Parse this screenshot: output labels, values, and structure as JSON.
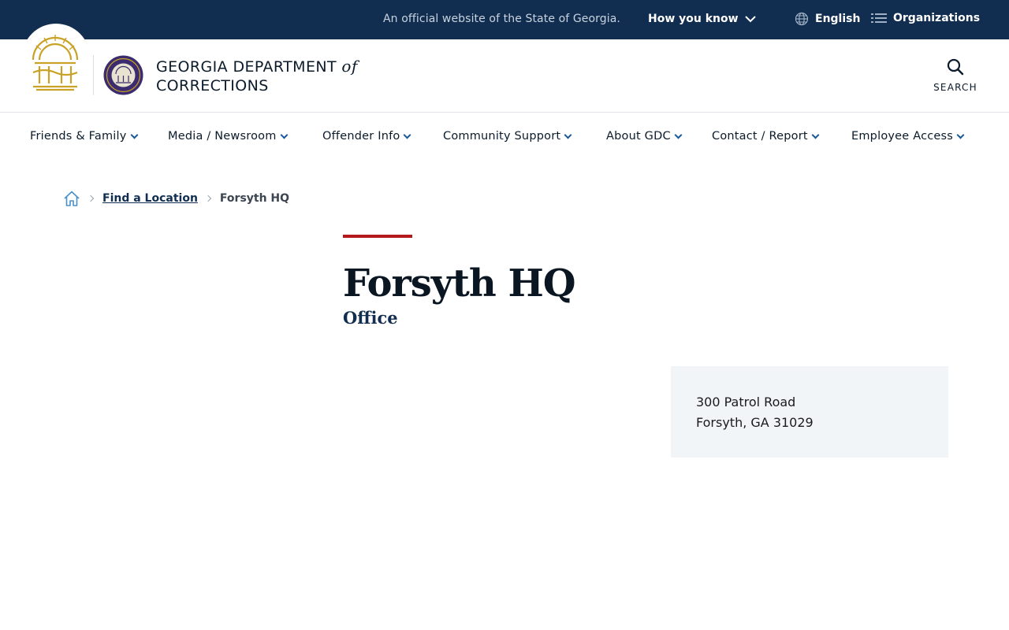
{
  "topbar": {
    "official_text": "An official website of the State of Georgia.",
    "how_you_know": "How you know",
    "language": "English",
    "organizations": "Organizations"
  },
  "header": {
    "agency_line1": "GEORGIA DEPARTMENT",
    "agency_of": "of",
    "agency_line2": "CORRECTIONS",
    "search_label": "SEARCH"
  },
  "nav": {
    "items": [
      {
        "label": "Friends & Family"
      },
      {
        "label": "Media / Newsroom"
      },
      {
        "label": "Offender Info"
      },
      {
        "label": "Community Support"
      },
      {
        "label": "About GDC"
      },
      {
        "label": "Contact / Report"
      },
      {
        "label": "Employee Access"
      }
    ]
  },
  "breadcrumb": {
    "items": [
      {
        "label": "Find a Location"
      },
      {
        "label": "Forsyth HQ"
      }
    ]
  },
  "page": {
    "title": "Forsyth HQ",
    "subtitle": "Office"
  },
  "address": {
    "line1": "300 Patrol Road",
    "line2": "Forsyth, GA 31029"
  },
  "colors": {
    "topbar_bg": "#112e51",
    "accent_red": "#b4191c",
    "seal_gold": "#c9a227",
    "chevron_blue": "#1a5a9a",
    "card_bg": "#f2f5f8"
  },
  "icons": {
    "language": "globe-icon",
    "organizations": "list-icon",
    "search": "search-icon",
    "home": "home-icon",
    "dropdown": "chevron-down-icon"
  }
}
